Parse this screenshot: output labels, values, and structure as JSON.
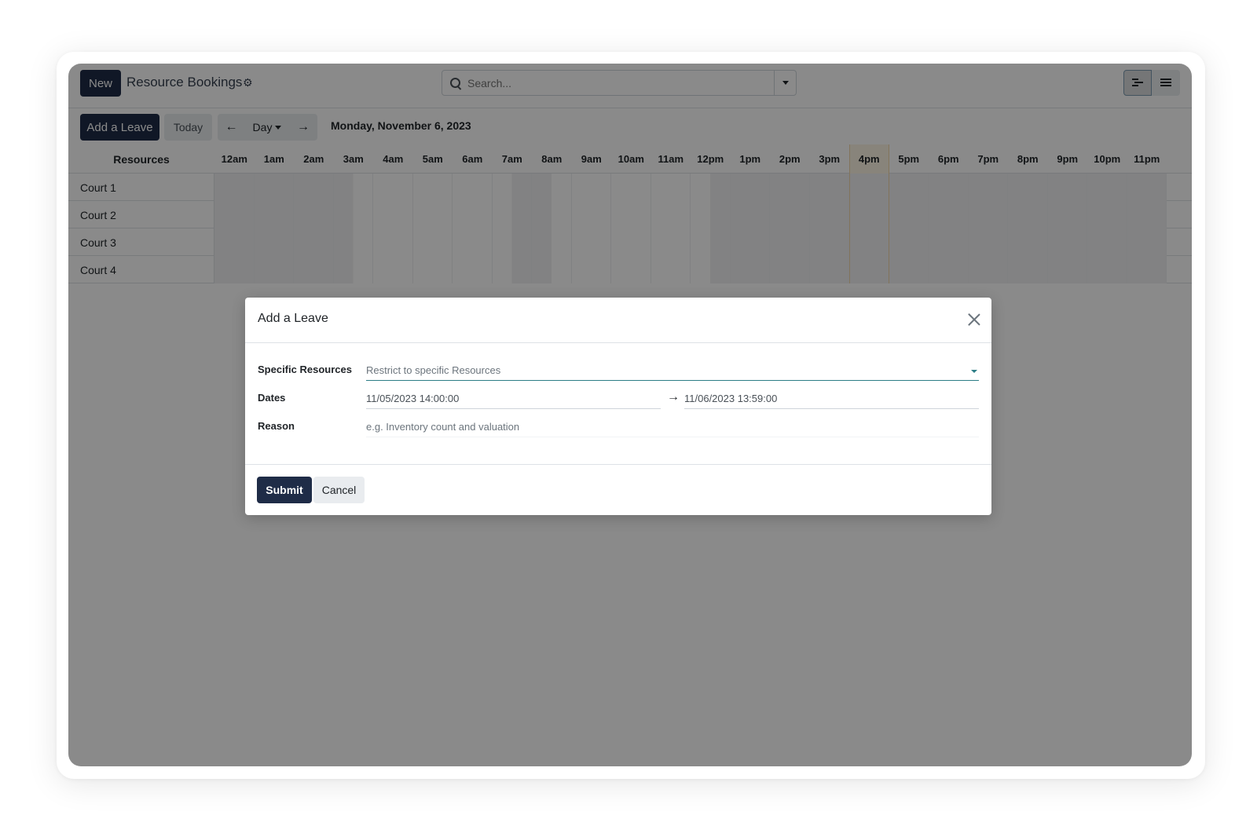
{
  "control_panel": {
    "new_label": "New",
    "title": "Resource Bookings",
    "search_placeholder": "Search...",
    "add_leave_label": "Add a Leave",
    "today_label": "Today",
    "prev_arrow": "←",
    "scale_label": "Day",
    "next_arrow": "→",
    "current_date": "Monday, November 6, 2023",
    "views": [
      "gantt-view-icon",
      "list-view-icon"
    ]
  },
  "gantt": {
    "resources_title": "Resources",
    "hours": [
      "12am",
      "1am",
      "2am",
      "3am",
      "4am",
      "5am",
      "6am",
      "7am",
      "8am",
      "9am",
      "10am",
      "11am",
      "12pm",
      "1pm",
      "2pm",
      "3pm",
      "4pm",
      "5pm",
      "6pm",
      "7pm",
      "8pm",
      "9pm",
      "10pm",
      "11pm"
    ],
    "highlighted_hour": "4pm",
    "rows": [
      "Court 1",
      "Court 2",
      "Court 3",
      "Court 4"
    ]
  },
  "dialog": {
    "title": "Add a Leave",
    "resources_label": "Specific Resources",
    "resources_placeholder": "Restrict to specific Resources",
    "dates_label": "Dates",
    "date_start": "11/05/2023 14:00:00",
    "date_arrow": "→",
    "date_end": "11/06/2023 13:59:00",
    "reason_label": "Reason",
    "reason_placeholder": "e.g. Inventory count and valuation",
    "submit_label": "Submit",
    "cancel_label": "Cancel"
  },
  "colors": {
    "primary_dark": "#1f2c47",
    "accent": "#2c7d86",
    "today_highlight": "#fbf4e4"
  }
}
